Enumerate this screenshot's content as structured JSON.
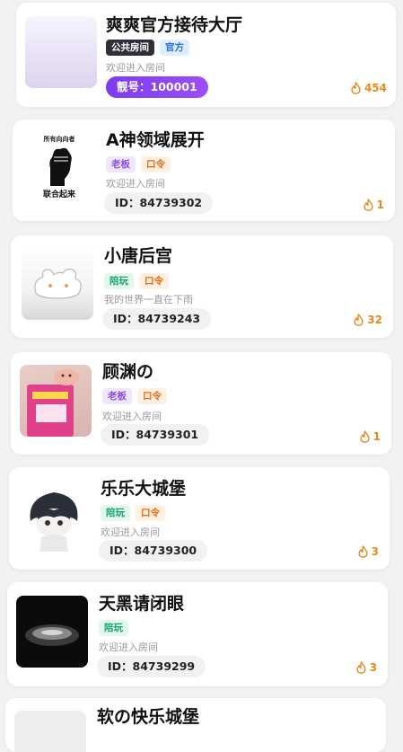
{
  "rooms": [
    {
      "title": "爽爽官方接待大厅",
      "tags": [
        {
          "label": "公共房间",
          "kind": "public"
        },
        {
          "label": "官方",
          "kind": "official"
        }
      ],
      "desc": "欢迎进入房间",
      "id_label": "靓号：100001",
      "heat": "454",
      "avatar": "lavender-placeholder"
    },
    {
      "title": "A神领域展开",
      "tags": [
        {
          "label": "老板",
          "kind": "boss"
        },
        {
          "label": "口令",
          "kind": "pw"
        }
      ],
      "desc": "欢迎进入房间",
      "id_label": "ID：84739302",
      "heat": "1",
      "avatar": "raised-fist",
      "avatar_text_top": "所有向向者",
      "avatar_text_bottom": "联合起来"
    },
    {
      "title": "小唐后宫",
      "tags": [
        {
          "label": "陪玩",
          "kind": "play"
        },
        {
          "label": "口令",
          "kind": "pw"
        }
      ],
      "desc": "我的世界一直在下雨",
      "id_label": "ID：84739243",
      "heat": "32",
      "avatar": "cute-blob"
    },
    {
      "title": "顾渊の",
      "tags": [
        {
          "label": "老板",
          "kind": "boss"
        },
        {
          "label": "口令",
          "kind": "pw"
        }
      ],
      "desc": "欢迎进入房间",
      "id_label": "ID：84739301",
      "heat": "1",
      "avatar": "pink-book-pig"
    },
    {
      "title": "乐乐大城堡",
      "tags": [
        {
          "label": "陪玩",
          "kind": "play"
        },
        {
          "label": "口令",
          "kind": "pw"
        }
      ],
      "desc": "欢迎进入房间",
      "id_label": "ID：84739300",
      "heat": "3",
      "avatar": "anime-boy"
    },
    {
      "title": "天黑请闭眼",
      "tags": [
        {
          "label": "陪玩",
          "kind": "play"
        }
      ],
      "desc": "欢迎进入房间",
      "id_label": "ID：84739299",
      "heat": "3",
      "avatar": "dark-photo"
    },
    {
      "title": "软の快乐城堡",
      "tags": [],
      "desc": "",
      "id_label": "",
      "heat": "",
      "avatar": "partial"
    }
  ],
  "colors": {
    "accent": "#8a4fe0",
    "heat": "#e8891a",
    "background": "#f2f2f4"
  }
}
